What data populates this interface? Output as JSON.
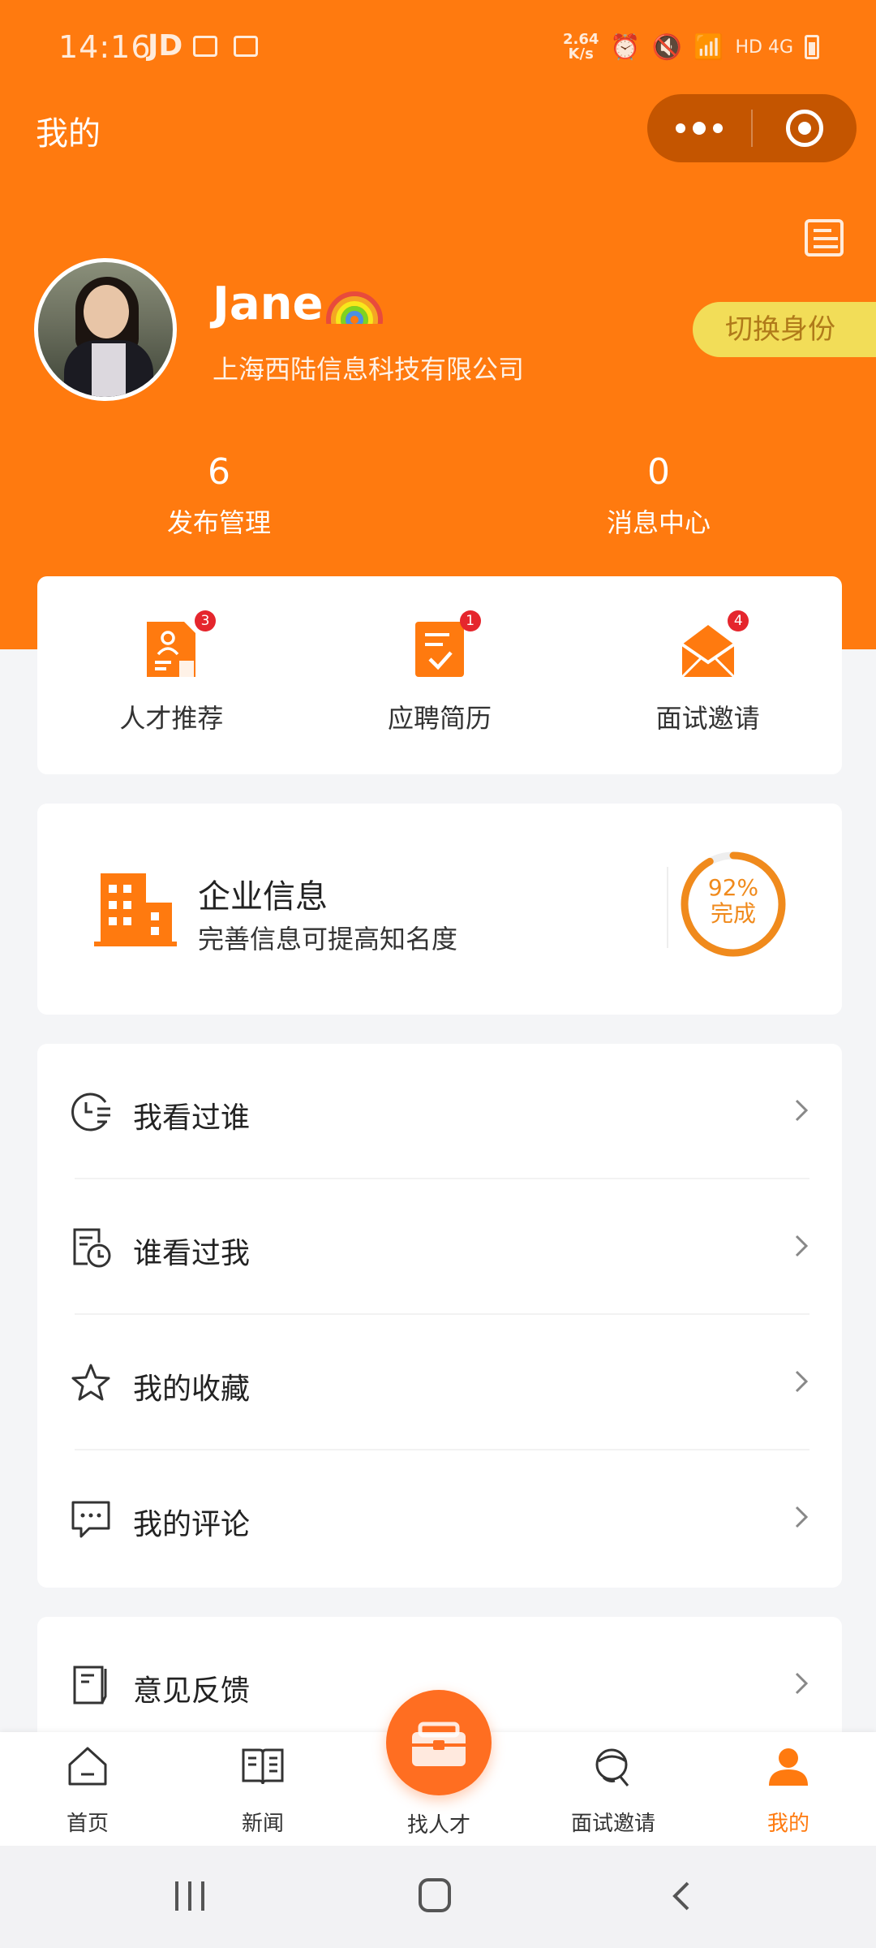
{
  "status_bar": {
    "time": "14:16",
    "carrier": "JD",
    "speed": "2.64\nK/s",
    "network": "HD 4G"
  },
  "header": {
    "title": "我的"
  },
  "capsule": {
    "more_icon": "more-dots-icon",
    "close_icon": "target-icon"
  },
  "profile": {
    "name": "Jane",
    "emoji": "rainbow",
    "company": "上海西陆信息科技有限公司",
    "switch_label": "切换身份"
  },
  "stats": [
    {
      "value": "6",
      "label": "发布管理"
    },
    {
      "value": "0",
      "label": "消息中心"
    }
  ],
  "quick_actions": [
    {
      "label": "人才推荐",
      "badge": "3",
      "icon": "talent-doc-icon"
    },
    {
      "label": "应聘简历",
      "badge": "1",
      "icon": "resume-check-icon"
    },
    {
      "label": "面试邀请",
      "badge": "4",
      "icon": "envelope-icon"
    }
  ],
  "company_info": {
    "title": "企业信息",
    "subtitle": "完善信息可提高知名度",
    "progress_percent": "92%",
    "progress_label": "完成",
    "progress_value": 0.92
  },
  "menu": [
    {
      "label": "我看过谁",
      "icon": "clock-list-icon"
    },
    {
      "label": "谁看过我",
      "icon": "history-doc-icon"
    },
    {
      "label": "我的收藏",
      "icon": "star-icon"
    },
    {
      "label": "我的评论",
      "icon": "comment-icon"
    }
  ],
  "feedback": {
    "label": "意见反馈",
    "icon": "feedback-icon"
  },
  "tabs": [
    {
      "label": "首页",
      "icon": "home-icon"
    },
    {
      "label": "新闻",
      "icon": "news-book-icon"
    },
    {
      "label": "找人才",
      "icon": "briefcase-icon"
    },
    {
      "label": "面试邀请",
      "icon": "interview-icon"
    },
    {
      "label": "我的",
      "icon": "user-icon",
      "active": true
    }
  ],
  "colors": {
    "brand": "#ff7a0f",
    "badge": "#e5262d",
    "switch_bg": "#f2dd58",
    "progress": "#f08a1c"
  }
}
